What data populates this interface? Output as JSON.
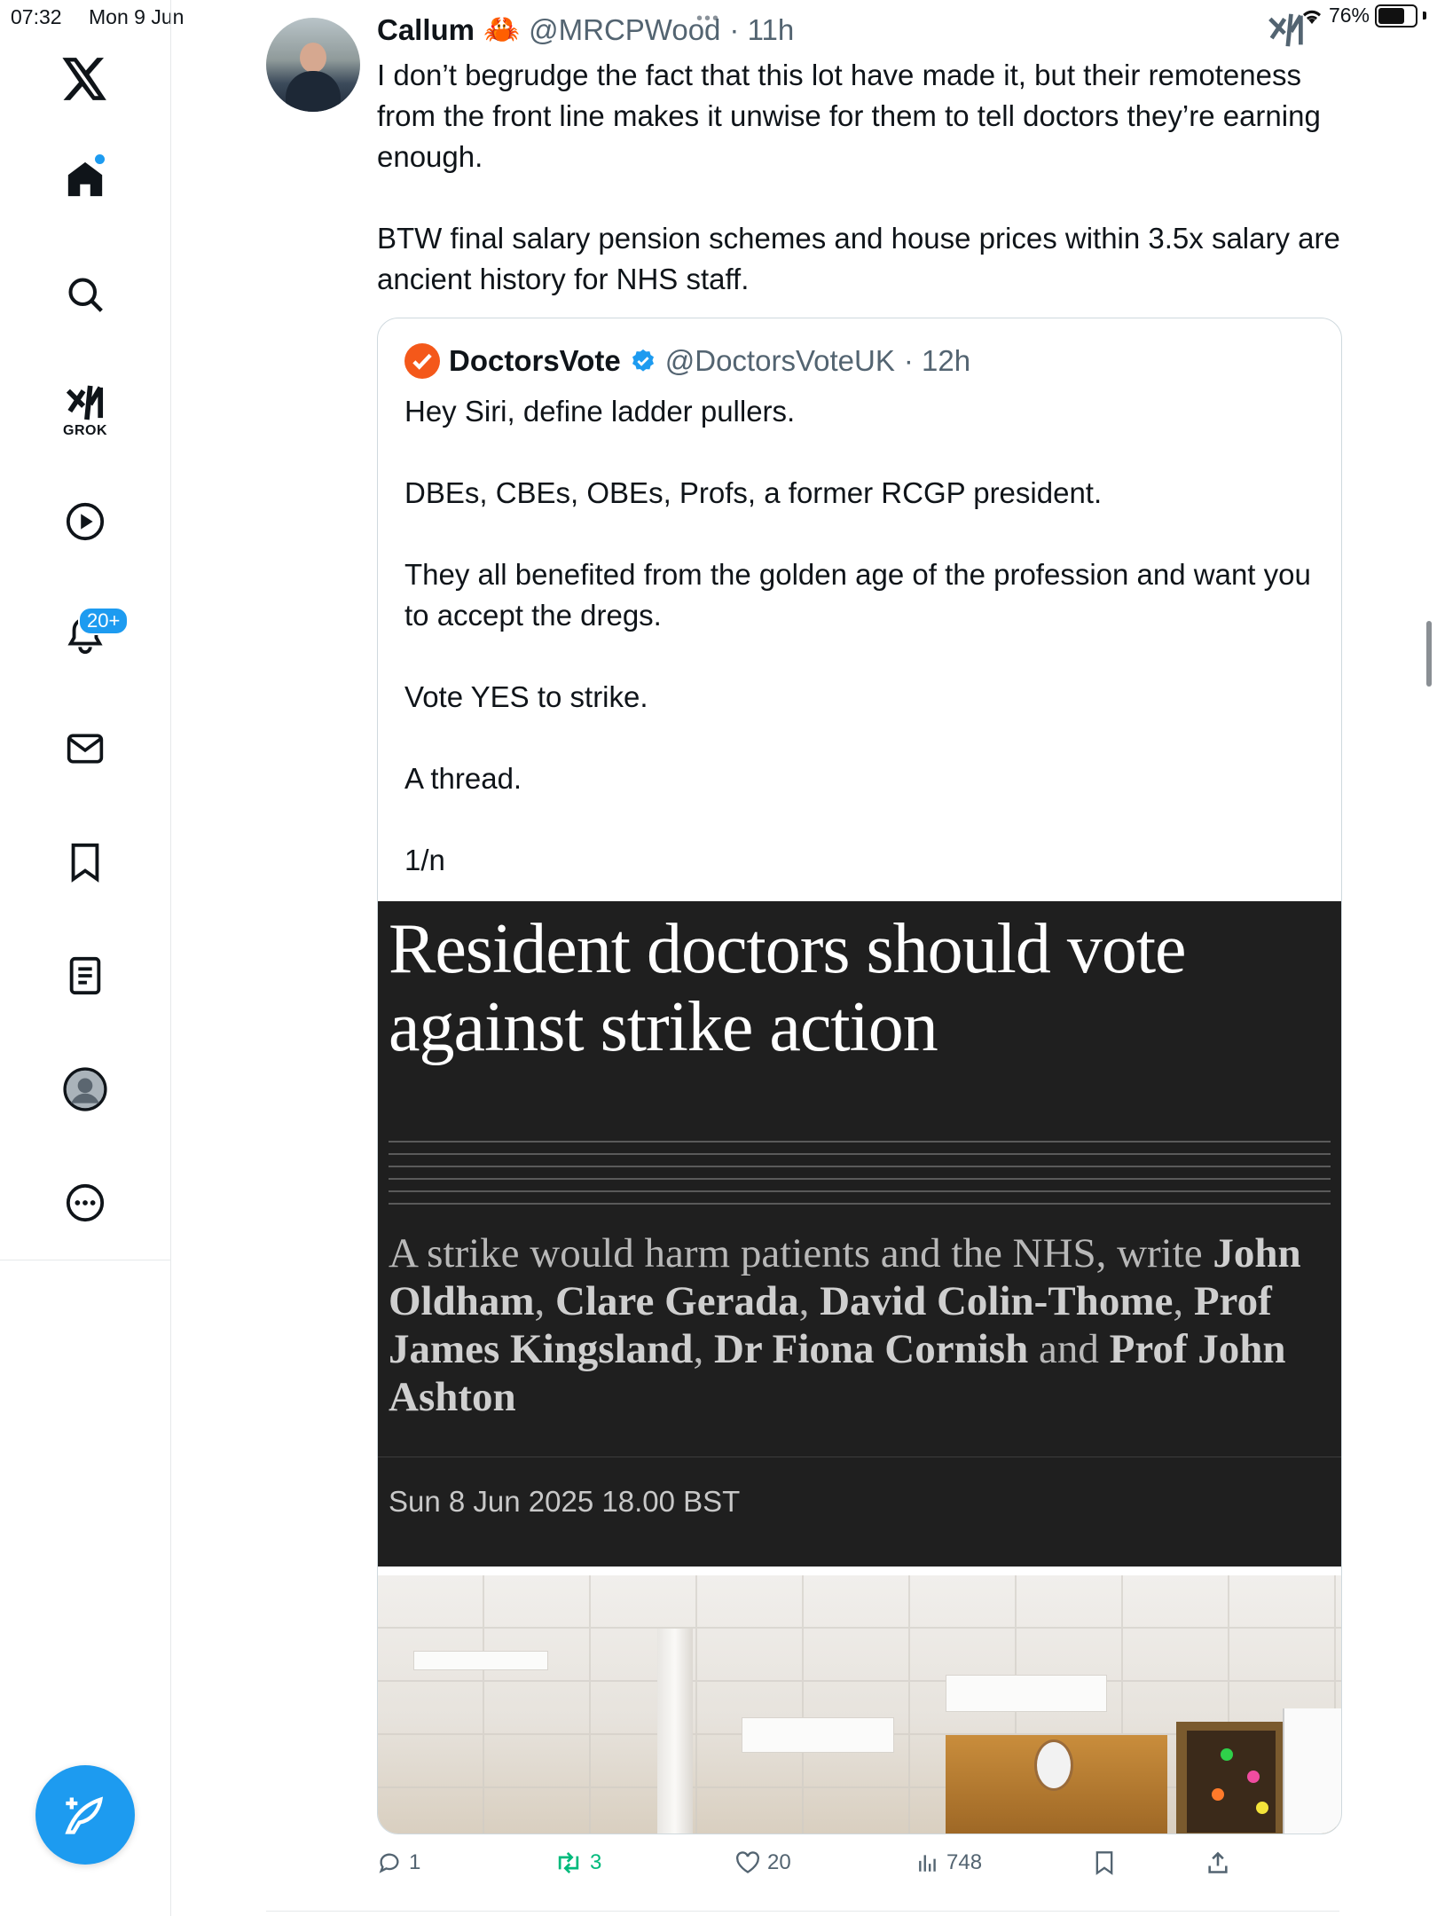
{
  "status_bar": {
    "time": "07:32",
    "date": "Mon 9 Jun",
    "battery": "76%",
    "battery_level": 0.76
  },
  "sidebar": {
    "badge_count": "20+",
    "grok_label": "GROK",
    "icons": [
      "x-logo-icon",
      "home-icon",
      "search-icon",
      "grok-icon",
      "video-icon",
      "notifications-icon",
      "messages-icon",
      "bookmarks-icon",
      "lists-icon",
      "profile-icon",
      "more-icon"
    ]
  },
  "tweet": {
    "name": "Callum",
    "emoji": "🦀",
    "handle": "@MRCPWood",
    "time": "· 11h",
    "text": "I don’t begrudge the fact that this lot have made it, but their remoteness from the front line makes it unwise for them to tell doctors they’re earning enough.\n\nBTW final salary pension schemes and house prices within 3.5x salary are ancient history for NHS staff."
  },
  "quote": {
    "name": "DoctorsVote",
    "handle": "@DoctorsVoteUK",
    "time": "· 12h",
    "text": "Hey Siri, define ladder pullers.\n\nDBEs, CBEs, OBEs, Profs, a former RCGP president.\n\nThey all benefited from the golden age of the profession and want you to accept the dregs.\n\nVote YES to strike.\n\nA thread.\n\n1/n"
  },
  "article": {
    "headline": "Resident doctors should vote against strike action",
    "standfirst_prefix": "A strike would harm patients and the NHS, write ",
    "authors": [
      "John Oldham",
      "Clare Gerada",
      "David Colin-Thome",
      "Prof James Kingsland",
      "Dr Fiona Cornish",
      "Prof John Ashton"
    ],
    "sep_comma": ", ",
    "sep_and": " and ",
    "date": "Sun 8 Jun 2025 18.00 BST"
  },
  "actions": {
    "replies": "1",
    "reposts": "3",
    "likes": "20",
    "views": "748"
  },
  "colors": {
    "accent": "#1d9bf0",
    "repost": "#00ba7c",
    "verified_orange": "#f4581a",
    "article_bg": "#1f1f1f"
  }
}
